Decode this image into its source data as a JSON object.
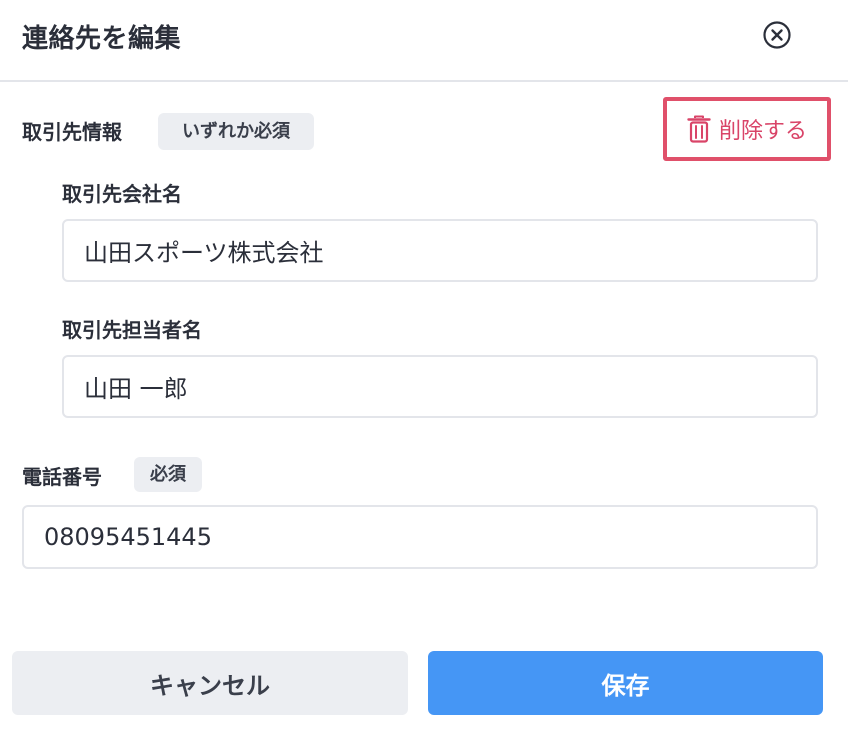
{
  "dialog": {
    "title": "連絡先を編集",
    "close_icon": "close-circle-icon"
  },
  "client_section": {
    "label": "取引先情報",
    "badge": "いずれか必須",
    "delete_label": "削除する",
    "delete_icon": "trash-icon",
    "delete_color": "#d94468"
  },
  "company_field": {
    "label": "取引先会社名",
    "value": "山田スポーツ株式会社"
  },
  "contact_field": {
    "label": "取引先担当者名",
    "value": "山田 一郎"
  },
  "phone_field": {
    "label": "電話番号",
    "badge": "必須",
    "value": "08095451445"
  },
  "footer": {
    "cancel_label": "キャンセル",
    "save_label": "保存",
    "save_color": "#4596f5"
  }
}
